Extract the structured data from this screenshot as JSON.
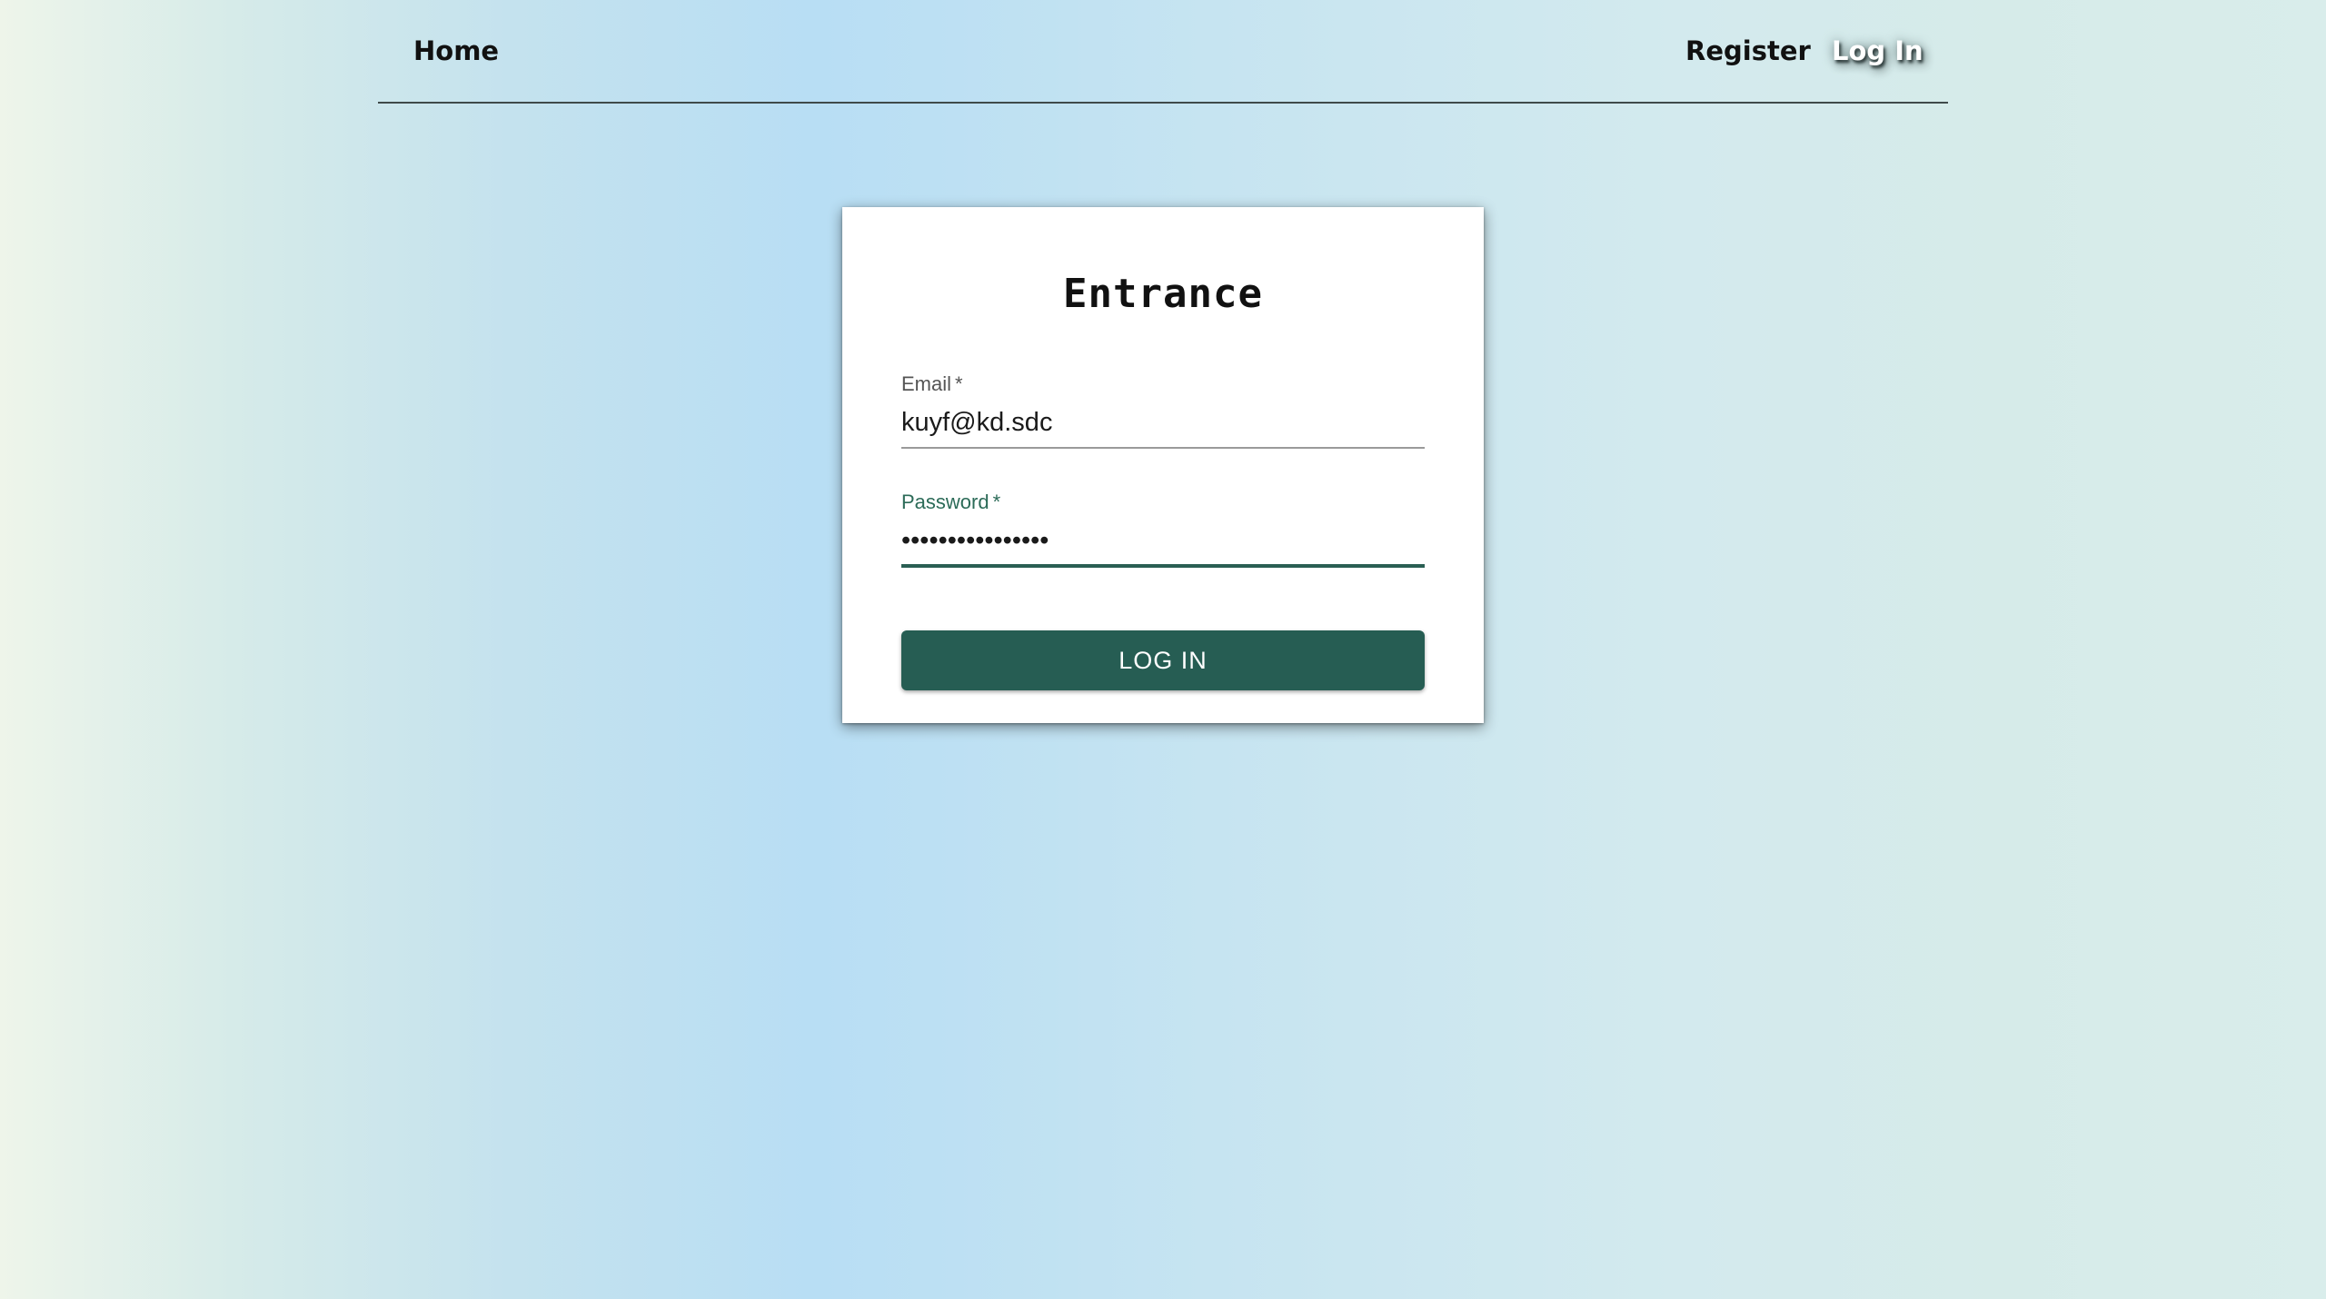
{
  "nav": {
    "home": "Home",
    "register": "Register",
    "login": "Log In"
  },
  "form": {
    "title": "Entrance",
    "email": {
      "label": "Email",
      "required_mark": "*",
      "value": "kuyf@kd.sdc"
    },
    "password": {
      "label": "Password",
      "required_mark": "*",
      "value": "••••••••••••••••"
    },
    "submit_label": "LOG IN"
  },
  "colors": {
    "accent": "#265d53",
    "focus_label": "#2c6b58"
  }
}
